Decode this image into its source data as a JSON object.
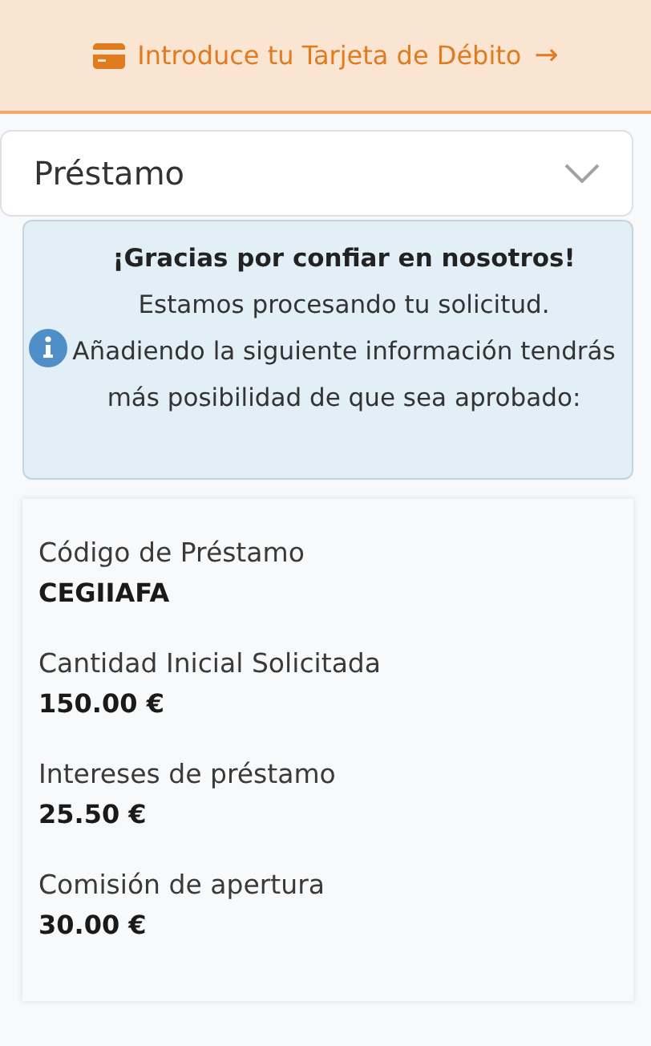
{
  "banner": {
    "label": "Introduce tu Tarjeta de Débito",
    "arrow": "→"
  },
  "select": {
    "value": "Préstamo"
  },
  "info": {
    "title": "¡Gracias por confiar en nosotros!",
    "text": "Estamos procesando tu solicitud. Añadiendo la siguiente información tendrás más posibilidad de que sea aprobado:"
  },
  "details": [
    {
      "label": "Código de Préstamo",
      "value": "CEGIIAFA"
    },
    {
      "label": "Cantidad Inicial Solicitada",
      "value": "150.00 €"
    },
    {
      "label": "Intereses de préstamo",
      "value": "25.50 €"
    },
    {
      "label": "Comisión de apertura",
      "value": "30.00 €"
    }
  ]
}
